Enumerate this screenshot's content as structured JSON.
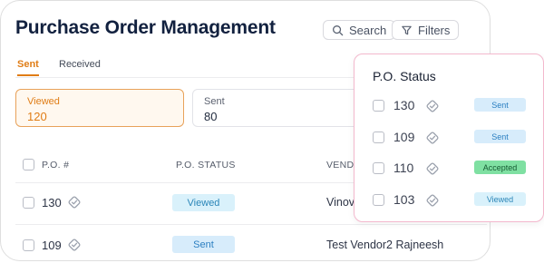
{
  "page": {
    "title": "Purchase Order Management"
  },
  "toolbar": {
    "search_label": "Search",
    "filters_label": "Filters"
  },
  "tabs": [
    {
      "label": "Sent",
      "active": true
    },
    {
      "label": "Received",
      "active": false
    }
  ],
  "stats": [
    {
      "label": "Viewed",
      "value": "120",
      "active": true
    },
    {
      "label": "Sent",
      "value": "80",
      "active": false
    }
  ],
  "table": {
    "columns": [
      "P.O. #",
      "P.O. STATUS",
      "VENDOR"
    ],
    "rows": [
      {
        "po": "130",
        "status": "Viewed",
        "vendor": "Vinov"
      },
      {
        "po": "109",
        "status": "Sent",
        "vendor": "Test Vendor2 Rajneesh"
      }
    ]
  },
  "overlay": {
    "title": "P.O. Status",
    "rows": [
      {
        "po": "130",
        "status": "Sent"
      },
      {
        "po": "109",
        "status": "Sent"
      },
      {
        "po": "110",
        "status": "Accepted"
      },
      {
        "po": "103",
        "status": "Viewed"
      }
    ]
  },
  "colors": {
    "accent": "#e07d16",
    "viewed_bg": "#d9f1fb",
    "sent_bg": "#d7ecfb",
    "accepted_bg": "#7fe0a2",
    "overlay_border": "#f3b8cd"
  },
  "icons": {
    "search": "search-icon",
    "filter": "filter-icon",
    "po_badge": "diamond-check-icon"
  }
}
